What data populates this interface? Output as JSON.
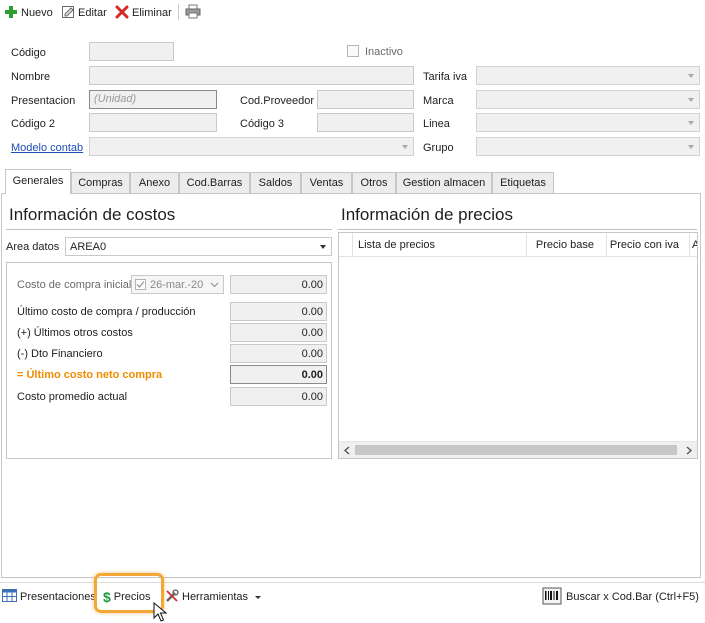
{
  "toolbar": {
    "new_label": "Nuevo",
    "edit_label": "Editar",
    "delete_label": "Eliminar"
  },
  "form": {
    "codigo_label": "Código",
    "inactivo_label": "Inactivo",
    "nombre_label": "Nombre",
    "tarifa_iva_label": "Tarifa iva",
    "presentacion_label": "Presentacion",
    "presentacion_placeholder": "(Unidad)",
    "cod_proveedor_label": "Cod.Proveedor",
    "marca_label": "Marca",
    "codigo2_label": "Código 2",
    "codigo3_label": "Código 3",
    "linea_label": "Linea",
    "modelo_contab_label": "Modelo contab",
    "grupo_label": "Grupo"
  },
  "tabs": [
    "Generales",
    "Compras",
    "Anexo",
    "Cod.Barras",
    "Saldos",
    "Ventas",
    "Otros",
    "Gestion almacen",
    "Etiquetas"
  ],
  "costos": {
    "title": "Información de costos",
    "area_label": "Area datos",
    "area_value": "AREA0",
    "costo_compra_inicial_label": "Costo de compra inicial",
    "costo_compra_inicial_date": "26-mar.-20",
    "costo_compra_inicial_value": "0.00",
    "ultimo_costo_label": "Último costo de compra / producción",
    "ultimo_costo_value": "0.00",
    "otros_costos_label": "(+) Últimos otros costos",
    "otros_costos_value": "0.00",
    "dto_financiero_label": "(-) Dto Financiero",
    "dto_financiero_value": "0.00",
    "neto_label": "= Último costo neto compra",
    "neto_value": "0.00",
    "promedio_label": "Costo promedio actual",
    "promedio_value": "0.00"
  },
  "precios": {
    "title": "Información de precios",
    "columns": [
      "Lista de precios",
      "Precio base",
      "Precio con iva",
      "A"
    ]
  },
  "bottombar": {
    "presentaciones_label": "Presentaciones",
    "precios_label": "Precios",
    "herramientas_label": "Herramientas",
    "buscar_label": "Buscar x Cod.Bar (Ctrl+F5)"
  },
  "colors": {
    "highlight": "#f4a734",
    "accent_orange": "#f08c00",
    "link": "#1a4fb4"
  }
}
